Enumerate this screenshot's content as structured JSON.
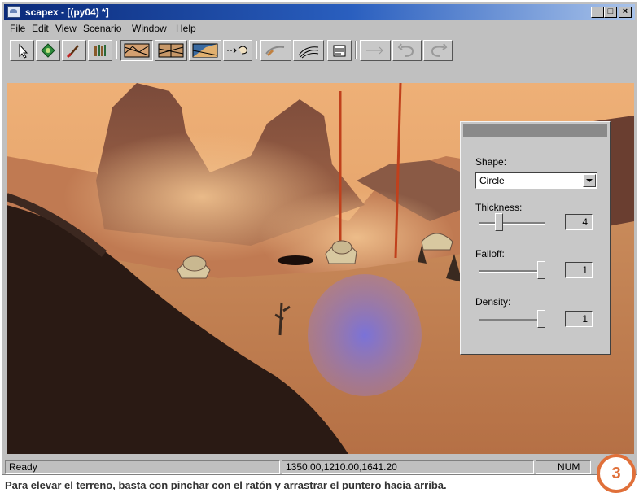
{
  "window": {
    "title": "scapex - [(py04) *]",
    "icon": "app-icon",
    "controls": {
      "minimize": "_",
      "maximize": "□",
      "close": "×"
    }
  },
  "menubar": {
    "items": [
      {
        "label": "File",
        "underline": "F"
      },
      {
        "label": "Edit",
        "underline": "E"
      },
      {
        "label": "View",
        "underline": "V"
      },
      {
        "label": "Scenario",
        "underline": "S"
      },
      {
        "label": "Window",
        "underline": "W"
      },
      {
        "label": "Help",
        "underline": "H"
      }
    ]
  },
  "toolbar": {
    "buttons": [
      {
        "icon": "select-arrow-icon"
      },
      {
        "icon": "place-object-icon"
      },
      {
        "icon": "paint-brush-icon"
      },
      {
        "icon": "object-library-icon"
      },
      {
        "icon": "terrain-raise-icon",
        "pressed": true
      },
      {
        "icon": "terrain-smooth-icon"
      },
      {
        "icon": "terrain-texture-icon"
      },
      {
        "icon": "path-tool-icon"
      },
      {
        "icon": "sweep-tool-icon"
      },
      {
        "icon": "wave-tool-icon"
      },
      {
        "icon": "properties-icon"
      },
      {
        "icon": "connect-icon",
        "disabled": true
      },
      {
        "icon": "redo-icon",
        "disabled": true
      },
      {
        "icon": "undo-icon",
        "disabled": true
      }
    ]
  },
  "brush_panel": {
    "shape_label": "Shape:",
    "shape_value": "Circle",
    "thickness_label": "Thickness:",
    "thickness_value": "4",
    "falloff_label": "Falloff:",
    "falloff_value": "1",
    "density_label": "Density:",
    "density_value": "1"
  },
  "statusbar": {
    "status": "Ready",
    "coordinates": "1350.00,1210.00,1641.20",
    "num": "NUM"
  },
  "badge": "3",
  "caption": "Para elevar el terreno, basta con pinchar con el ratón y arrastrar el puntero hacia arriba.",
  "colors": {
    "titlebar_start": "#0a2a7a",
    "titlebar_end": "#a9c3ea",
    "sky": "#e7a66b",
    "terrain_dark": "#2a1a14",
    "brush_highlight": "#7a6fd0",
    "badge": "#e0703a"
  }
}
